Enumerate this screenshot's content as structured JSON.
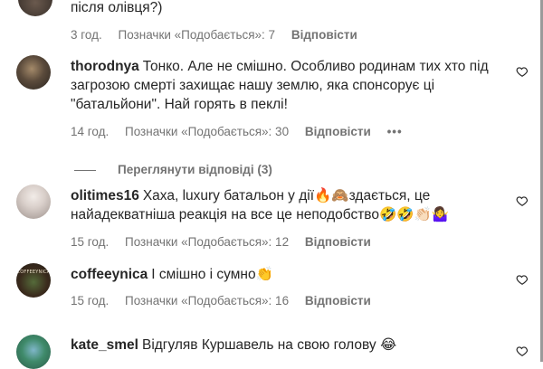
{
  "comments": [
    {
      "username": "",
      "text": "після олівця?)",
      "time": "3 год.",
      "likes": "Позначки «Подобається»: 7",
      "reply": "Відповісти"
    },
    {
      "username": "thorodnya",
      "text": "Тонко. Але не смішно. Особливо родинам тих хто під загрозою смерті захищає нашу землю, яка спонсорує ці \"батальйони\". Най горять в пеклі!",
      "time": "14 год.",
      "likes": "Позначки «Подобається»: 30",
      "reply": "Відповісти",
      "more": "•••"
    },
    {
      "username": "olitimes16",
      "text": "Хаха, luxury батальон у дії🔥🙈здається, це найадекватніша реакція на все це неподобство🤣🤣👏🏻🤷‍♀️",
      "time": "15 год.",
      "likes": "Позначки «Подобається»: 12",
      "reply": "Відповісти"
    },
    {
      "username": "coffeeynica",
      "avatar_text": "COFFEEYNICA",
      "text": "І смішно і сумно👏",
      "time": "15 год.",
      "likes": "Позначки «Подобається»: 16",
      "reply": "Відповісти"
    },
    {
      "username": "kate_smel",
      "text": "Відгуляв Куршавель на свою голову 😂"
    }
  ],
  "view_replies": "Переглянути відповіді (3)",
  "icons": {
    "like": "heart-icon",
    "more": "more-icon"
  }
}
